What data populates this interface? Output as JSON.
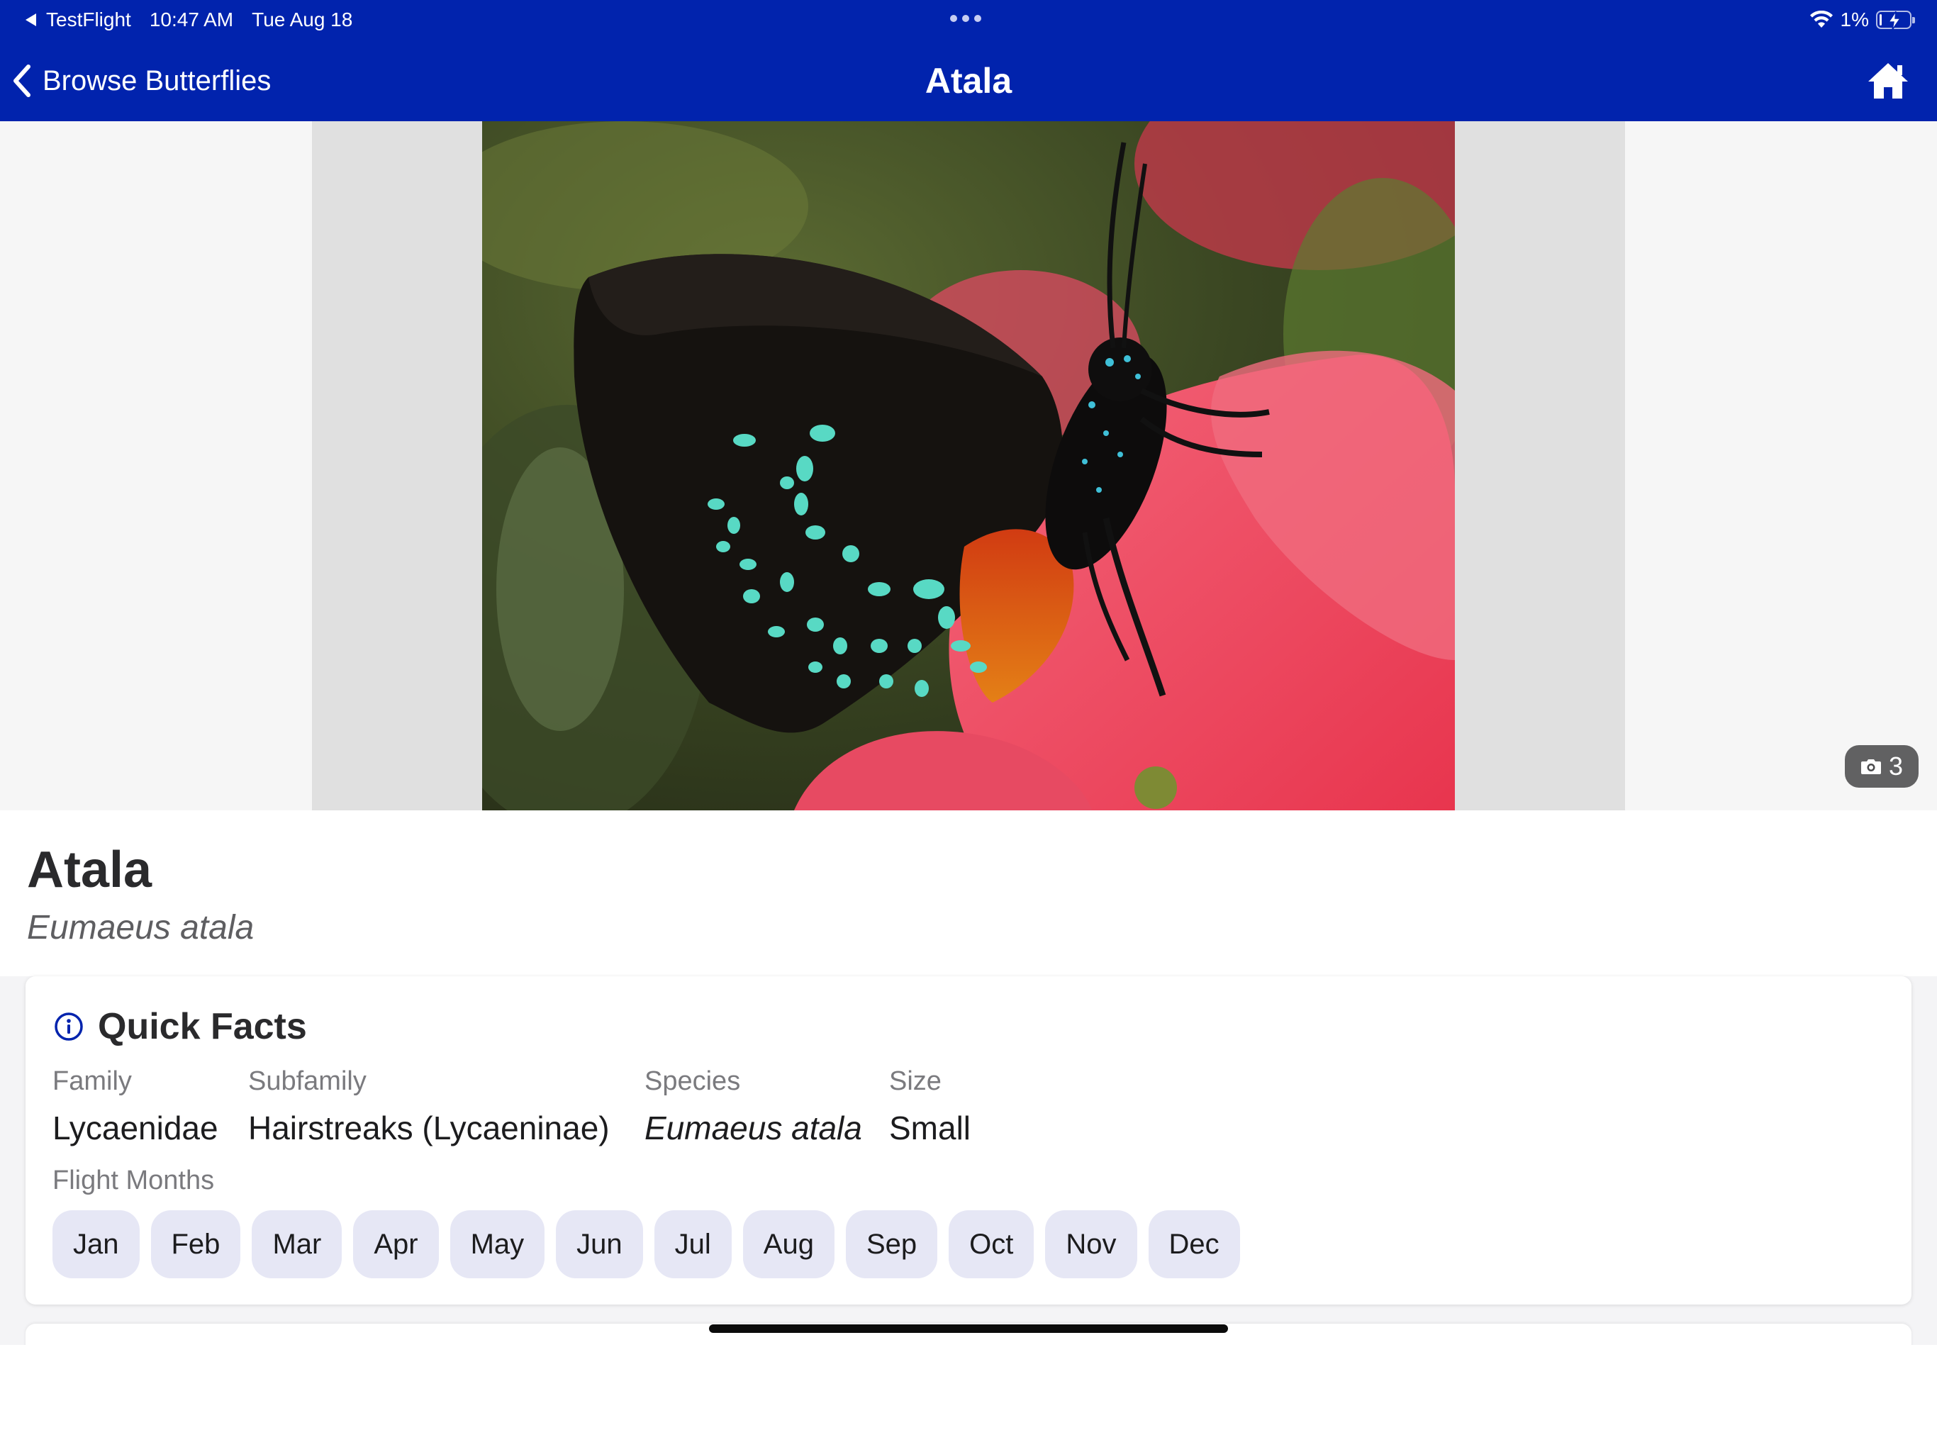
{
  "status_bar": {
    "back_app": "TestFlight",
    "time": "10:47 AM",
    "date": "Tue Aug 18",
    "battery": "1%"
  },
  "nav": {
    "back_label": "Browse Butterflies",
    "title": "Atala",
    "home_icon": "home-icon"
  },
  "gallery": {
    "photo_count": "3",
    "camera_icon": "camera-icon"
  },
  "species": {
    "common_name": "Atala",
    "scientific_name": "Eumaeus atala"
  },
  "quick_facts": {
    "title": "Quick Facts",
    "icon": "info-icon",
    "facts": [
      {
        "label": "Family",
        "value": "Lycaenidae"
      },
      {
        "label": "Subfamily",
        "value": "Hairstreaks (Lycaeninae)"
      },
      {
        "label": "Species",
        "value": "Eumaeus atala"
      },
      {
        "label": "Size",
        "value": "Small"
      }
    ],
    "flight_months_label": "Flight Months",
    "months": [
      "Jan",
      "Feb",
      "Mar",
      "Apr",
      "May",
      "Jun",
      "Jul",
      "Aug",
      "Sep",
      "Oct",
      "Nov",
      "Dec"
    ]
  },
  "colors": {
    "nav_bar": "#0123ad",
    "chip_bg": "#e6e7f5",
    "accent": "#0123ad"
  }
}
